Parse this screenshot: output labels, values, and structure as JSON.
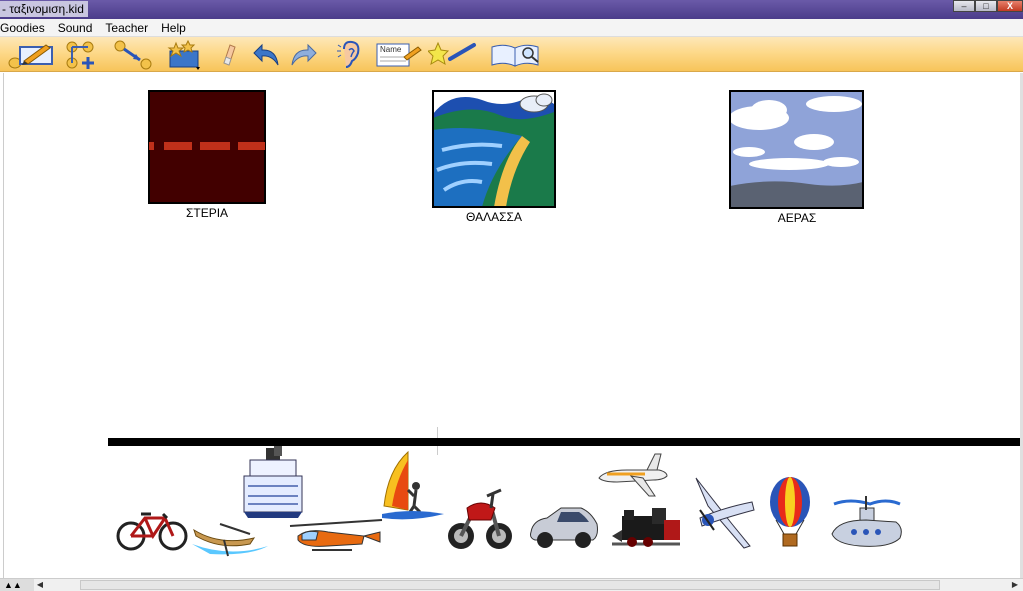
{
  "window": {
    "title": "- ταξινομιση.kid",
    "minimize": "–",
    "maximize": "□",
    "close": "X"
  },
  "menu": [
    "Goodies",
    "Sound",
    "Teacher",
    "Help"
  ],
  "toolbar": {
    "icons": [
      "pencil-slate-icon",
      "add-node-icon",
      "link-tool-icon",
      "star-box-icon",
      "eraser-icon",
      "undo-icon",
      "redo-icon",
      "ear-icon",
      "name-card-icon",
      "magic-wand-icon",
      "book-search-icon"
    ],
    "name_card_text": "Name"
  },
  "categories": [
    {
      "label": "ΣΤΕΡΙΑ",
      "icon": "road-icon"
    },
    {
      "label": "ΘΑΛΑΣΣΑ",
      "icon": "sea-coast-icon"
    },
    {
      "label": "ΑΕΡΑΣ",
      "icon": "sky-clouds-icon"
    }
  ],
  "stickers": [
    "bicycle",
    "rowboat",
    "cruise-ship",
    "helicopter",
    "windsurfer",
    "motorcycle",
    "car",
    "jet-plane",
    "steam-train",
    "propeller-plane",
    "hot-air-balloon",
    "submarine"
  ],
  "colors": {
    "toolbar": "#fdd98a",
    "titlebar": "#5a4a98",
    "road": "#420000",
    "sea": "#1d6fc0",
    "sky": "#8fa3d8"
  }
}
